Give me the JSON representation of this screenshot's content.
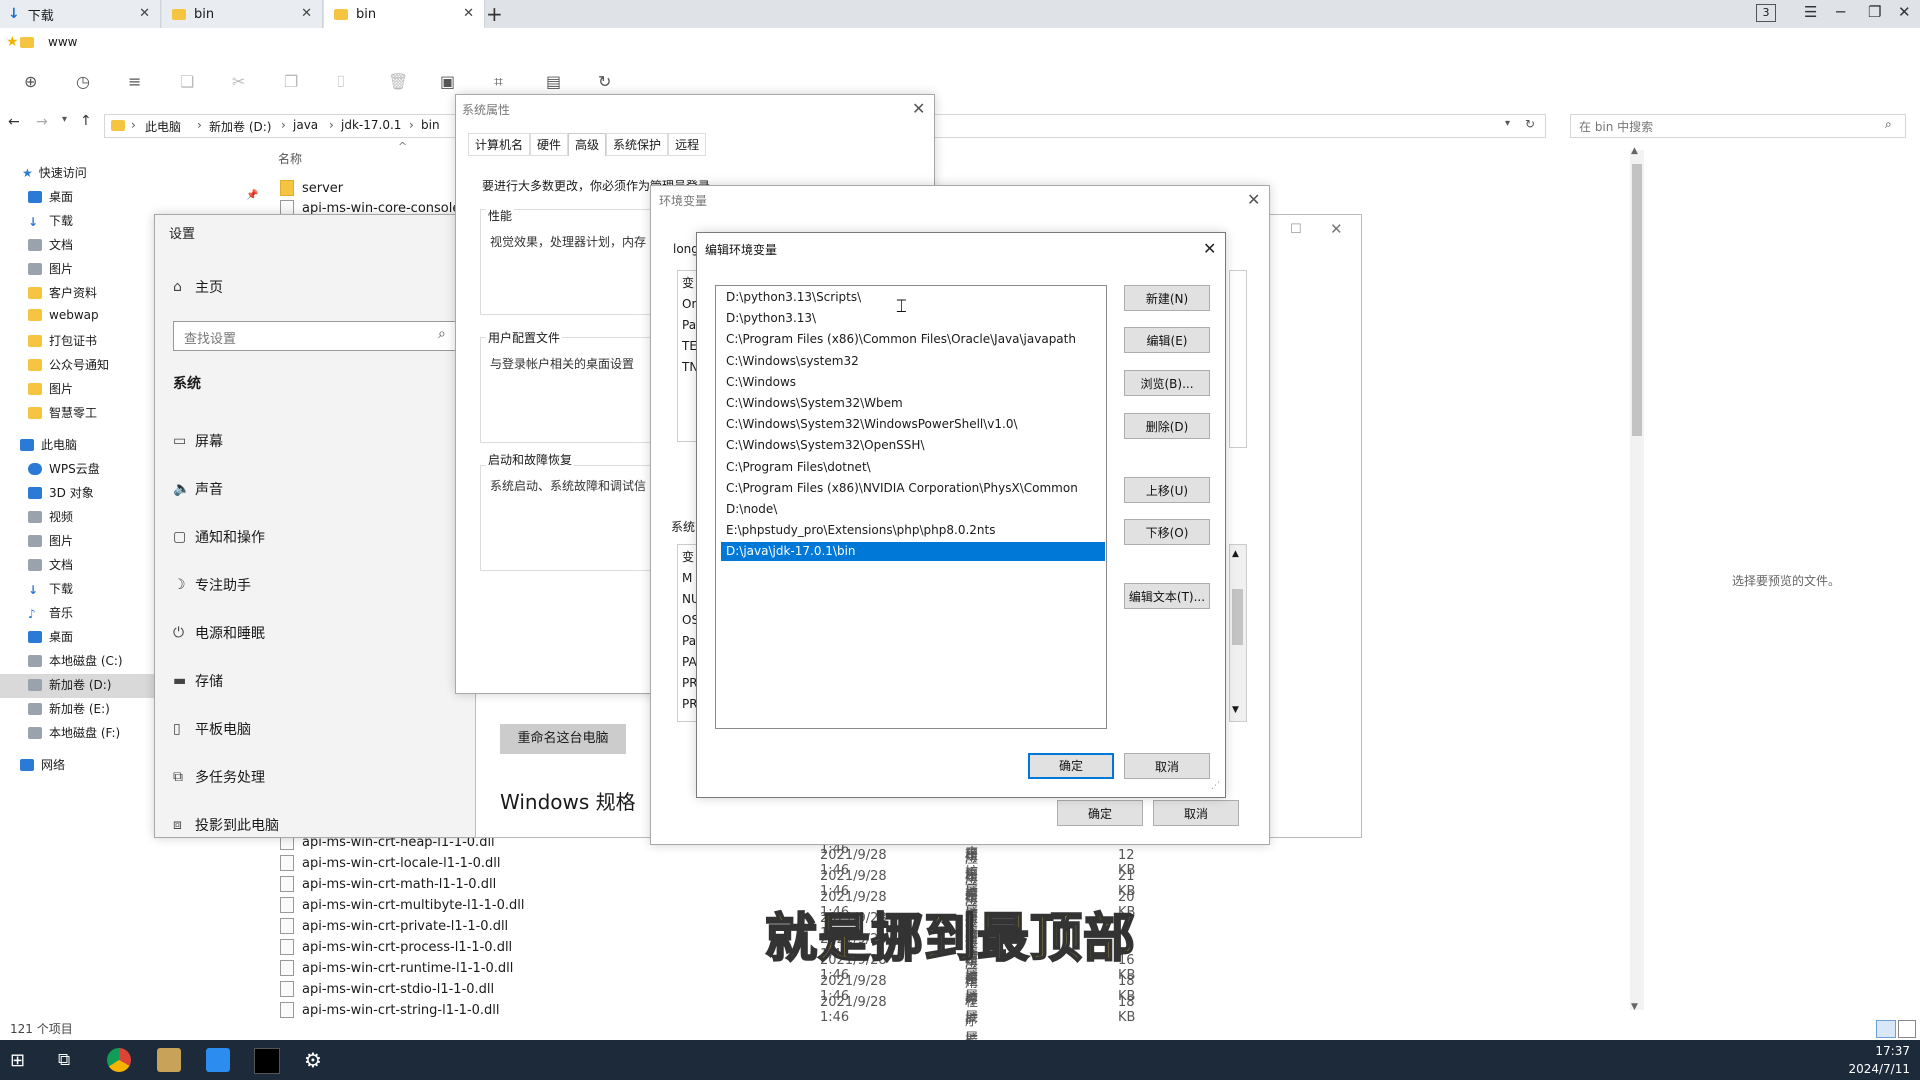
{
  "tabs": [
    {
      "label": "下载",
      "icon": "download-icon"
    },
    {
      "label": "bin",
      "icon": "folder-icon"
    },
    {
      "label": "bin",
      "icon": "folder-icon"
    }
  ],
  "tab_count": "3",
  "bookmarks": {
    "item": "www"
  },
  "address": {
    "segments": [
      "此电脑",
      "新加卷 (D:)",
      "java",
      "jdk-17.0.1",
      "bin"
    ],
    "search_placeholder": "在 bin 中搜索"
  },
  "sidebar": {
    "quick_access": "快速访问",
    "quick_items": [
      "桌面",
      "下载",
      "文档",
      "图片",
      "客户资料",
      "webwap",
      "打包证书",
      "公众号通知",
      "图片",
      "智慧零工"
    ],
    "this_pc": "此电脑",
    "pc_items": [
      "WPS云盘",
      "3D 对象",
      "视频",
      "图片",
      "文档",
      "下载",
      "音乐",
      "桌面",
      "本地磁盘 (C:)",
      "新加卷 (D:)",
      "新加卷 (E:)",
      "本地磁盘 (F:)"
    ],
    "network": "网络"
  },
  "filelist": {
    "column_name": "名称",
    "top_items": [
      "server",
      "api-ms-win-core-console-l"
    ],
    "rows": [
      {
        "name": "api-ms-win-crt-heap-l1-1-0.dll",
        "date": "2021/9/28 1:46",
        "type": "应用程序扩展",
        "size": ""
      },
      {
        "name": "api-ms-win-crt-locale-l1-1-0.dll",
        "date": "2021/9/28 1:46",
        "type": "应用程序扩展",
        "size": "12 KB"
      },
      {
        "name": "api-ms-win-crt-math-l1-1-0.dll",
        "date": "2021/9/28 1:46",
        "type": "应用程序扩展",
        "size": "21 KB"
      },
      {
        "name": "api-ms-win-crt-multibyte-l1-1-0.dll",
        "date": "2021/9/28 1:46",
        "type": "应用程序扩展",
        "size": "20 KB"
      },
      {
        "name": "api-ms-win-crt-private-l1-1-0.dll",
        "date": "2021/9/28 1:46",
        "type": "应用程序扩展",
        "size": ""
      },
      {
        "name": "api-ms-win-crt-process-l1-1-0.dll",
        "date": "2021/9/28 1:46",
        "type": "应用程序扩展",
        "size": ""
      },
      {
        "name": "api-ms-win-crt-runtime-l1-1-0.dll",
        "date": "2021/9/28 1:46",
        "type": "应用程序扩展",
        "size": "16 KB"
      },
      {
        "name": "api-ms-win-crt-stdio-l1-1-0.dll",
        "date": "2021/9/28 1:46",
        "type": "应用程序扩展",
        "size": "18 KB"
      },
      {
        "name": "api-ms-win-crt-string-l1-1-0.dll",
        "date": "2021/9/28 1:46",
        "type": "应用程序扩展",
        "size": "18 KB"
      }
    ],
    "item_count": "121 个项目",
    "preview_text": "选择要预览的文件。"
  },
  "settings": {
    "title": "设置",
    "home": "主页",
    "search_placeholder": "查找设置",
    "section": "系统",
    "items": [
      "屏幕",
      "声音",
      "通知和操作",
      "专注助手",
      "电源和睡眠",
      "存储",
      "平板电脑",
      "多任务处理",
      "投影到此电脑"
    ],
    "rename_button": "重命名这台电脑",
    "windows_spec": "Windows 规格"
  },
  "sysprops": {
    "title": "系统属性",
    "tabs": [
      "计算机名",
      "硬件",
      "高级",
      "系统保护",
      "远程"
    ],
    "note": "要进行大多数更改，你必须作为管理员登录。",
    "perf_label": "性能",
    "perf_text": "视觉效果，处理器计划，内存",
    "profile_label": "用户配置文件",
    "profile_text": "与登录帐户相关的桌面设置",
    "startup_label": "启动和故障恢复",
    "startup_text": "系统启动、系统故障和调试信"
  },
  "envvars": {
    "title": "环境变量",
    "user_label": "long",
    "sys_label": "系统",
    "user_rows": [
      "变",
      "Or",
      "Pa",
      "TE",
      "TN"
    ],
    "sys_rows": [
      "变",
      "M",
      "NU",
      "OS",
      "Pa",
      "PA",
      "PR",
      "PR"
    ],
    "ok": "确定",
    "cancel": "取消"
  },
  "editenv": {
    "title": "编辑环境变量",
    "paths": [
      "D:\\python3.13\\Scripts\\",
      "D:\\python3.13\\",
      "C:\\Program Files (x86)\\Common Files\\Oracle\\Java\\javapath",
      "C:\\Windows\\system32",
      "C:\\Windows",
      "C:\\Windows\\System32\\Wbem",
      "C:\\Windows\\System32\\WindowsPowerShell\\v1.0\\",
      "C:\\Windows\\System32\\OpenSSH\\",
      "C:\\Program Files\\dotnet\\",
      "C:\\Program Files (x86)\\NVIDIA Corporation\\PhysX\\Common",
      "D:\\node\\",
      "E:\\phpstudy_pro\\Extensions\\php\\php8.0.2nts",
      "D:\\java\\jdk-17.0.1\\bin"
    ],
    "selected_index": 12,
    "buttons": {
      "new": "新建(N)",
      "edit": "编辑(E)",
      "browse": "浏览(B)...",
      "delete": "删除(D)",
      "up": "上移(U)",
      "down": "下移(O)",
      "edit_text": "编辑文本(T)...",
      "ok": "确定",
      "cancel": "取消"
    }
  },
  "subtitle": "就是挪到最顶部",
  "clock": {
    "time": "17:37",
    "date": "2024/7/11"
  },
  "colors": {
    "accent": "#0078d7",
    "subtitle": "#f6d64a",
    "taskbar": "#1c2a3a"
  }
}
